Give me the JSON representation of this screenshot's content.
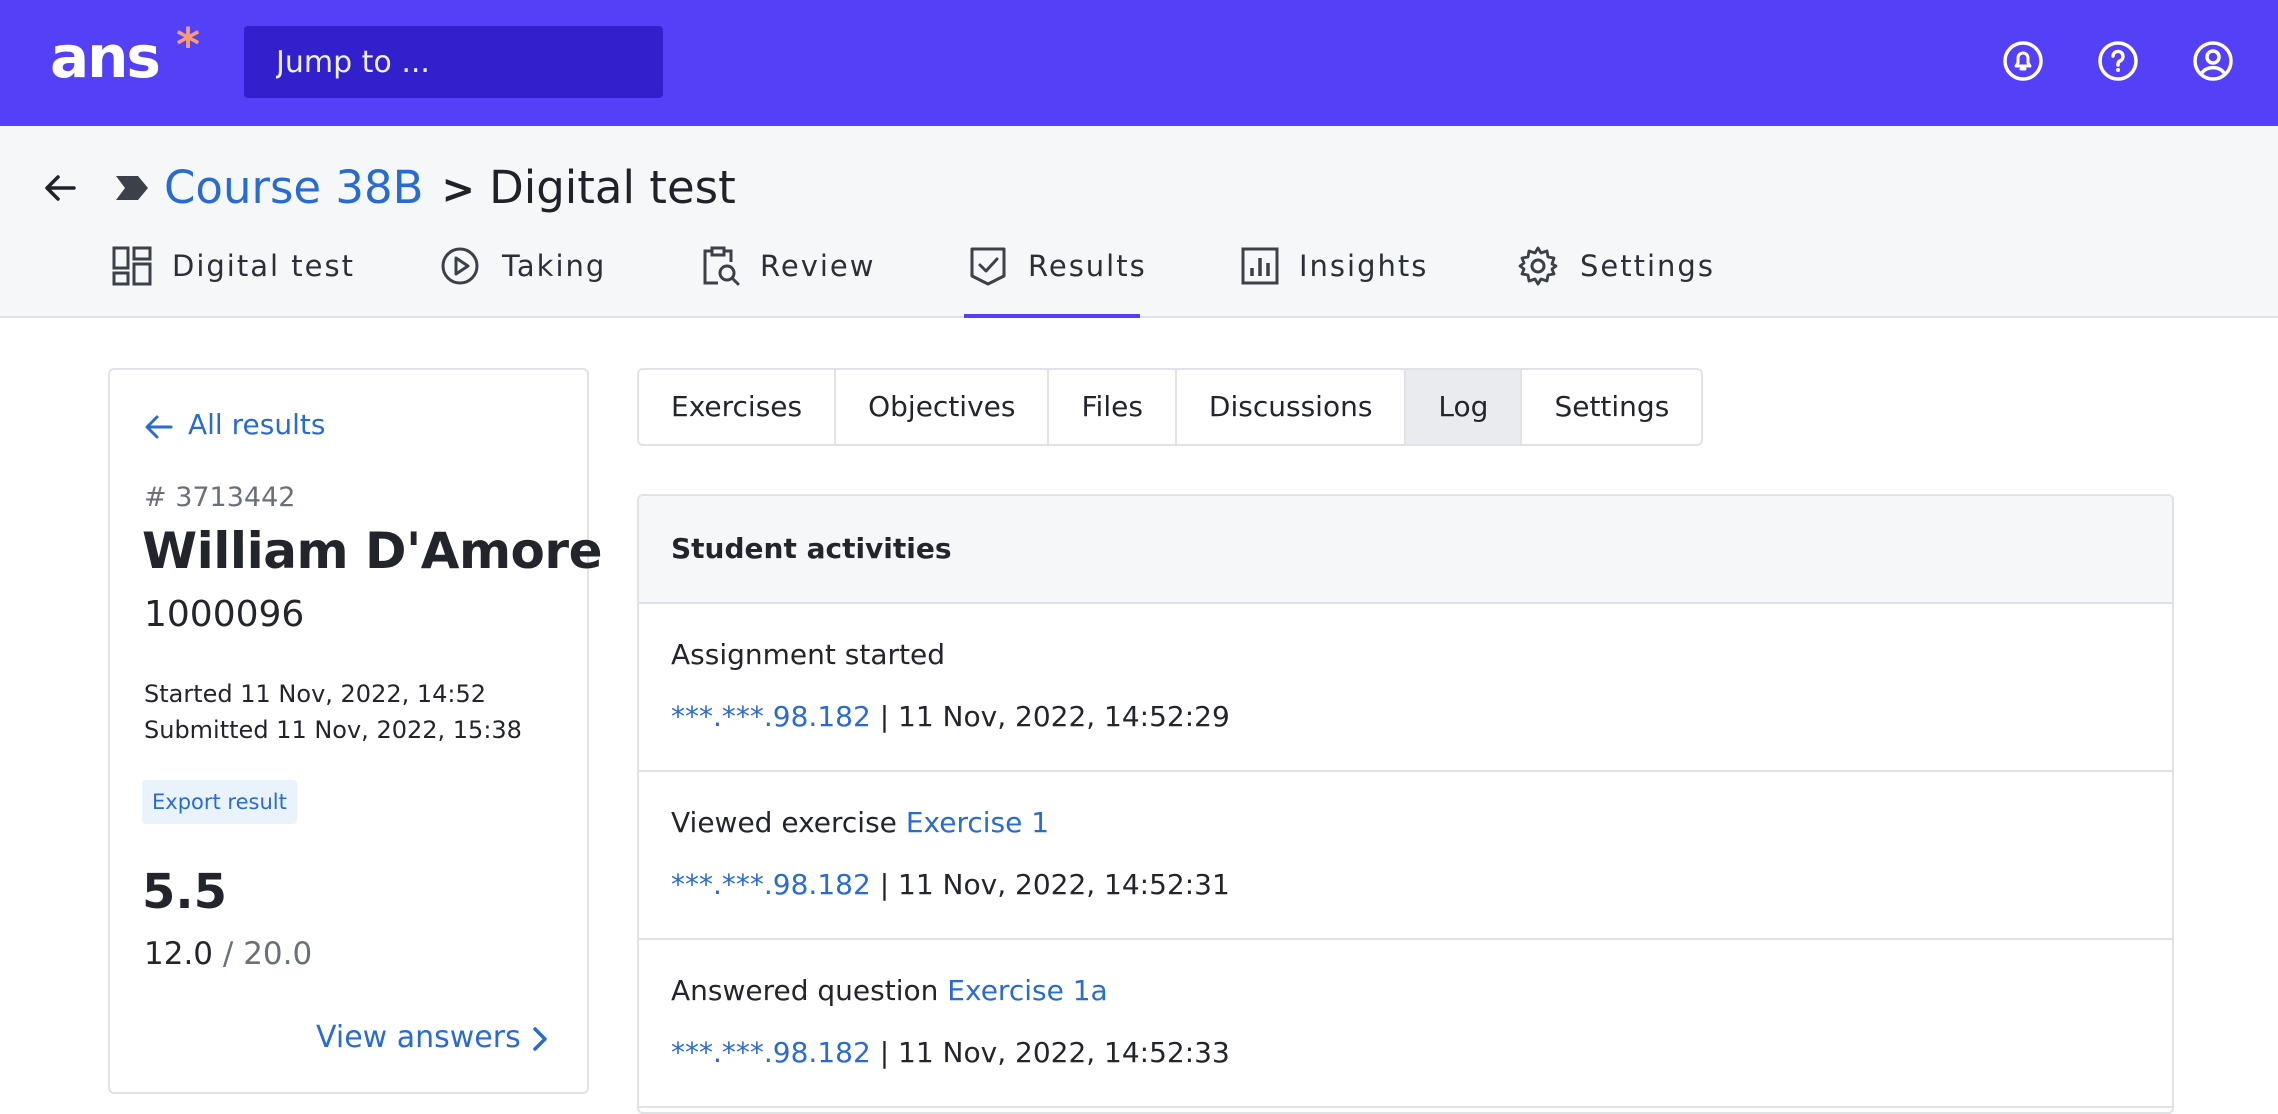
{
  "topbar": {
    "logo_text": "ans",
    "logo_star": "*",
    "jump_placeholder": "Jump to ...",
    "icons": [
      "bell-icon",
      "help-icon",
      "account-icon"
    ],
    "background": "#5340f7"
  },
  "breadcrumb": {
    "course": "Course 38B",
    "separator": ">",
    "current": "Digital test"
  },
  "nav_tabs": [
    {
      "label": "Digital test",
      "icon": "dashboard-icon"
    },
    {
      "label": "Taking",
      "icon": "play-circle-icon"
    },
    {
      "label": "Review",
      "icon": "clipboard-search-icon"
    },
    {
      "label": "Results",
      "icon": "shield-check-icon",
      "active": true
    },
    {
      "label": "Insights",
      "icon": "bar-chart-icon"
    },
    {
      "label": "Settings",
      "icon": "gear-icon"
    }
  ],
  "result_card": {
    "all_results_label": "All results",
    "result_id": "# 3713442",
    "student_name": "William D'Amore",
    "student_number": "1000096",
    "started": "Started 11 Nov, 2022, 14:52",
    "submitted": "Submitted 11 Nov, 2022, 15:38",
    "export_label": "Export result",
    "score": "5.5",
    "points": "12.0",
    "points_max": "/ 20.0",
    "view_answers_label": "View answers"
  },
  "sub_tabs": [
    {
      "label": "Exercises"
    },
    {
      "label": "Objectives"
    },
    {
      "label": "Files"
    },
    {
      "label": "Discussions"
    },
    {
      "label": "Log",
      "active": true
    },
    {
      "label": "Settings"
    }
  ],
  "activities": {
    "heading": "Student activities",
    "entries": [
      {
        "text": "Assignment started",
        "link": "",
        "ip": "***.***.98.182",
        "time": "| 11 Nov, 2022, 14:52:29"
      },
      {
        "text": "Viewed exercise",
        "link": "Exercise 1",
        "ip": "***.***.98.182",
        "time": "| 11 Nov, 2022, 14:52:31"
      },
      {
        "text": "Answered question",
        "link": "Exercise 1a",
        "ip": "***.***.98.182",
        "time": "| 11 Nov, 2022, 14:52:33"
      }
    ]
  },
  "colors": {
    "accent": "#5340f7",
    "link": "#2a6bd1",
    "text": "#1f2329"
  }
}
